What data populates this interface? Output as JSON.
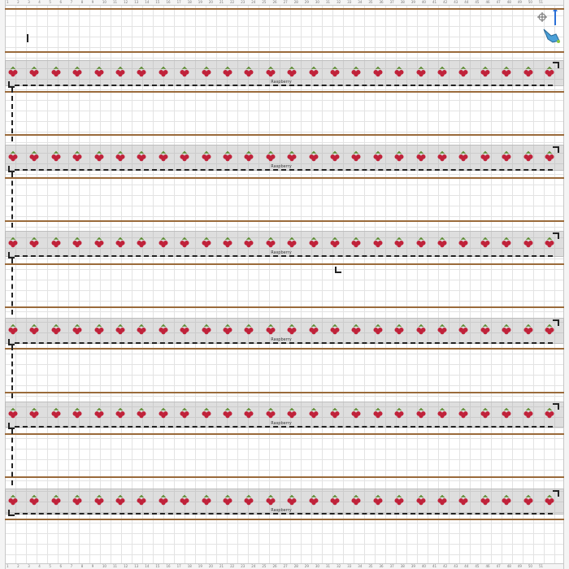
{
  "plot": {
    "crop_label": "Raspberry",
    "rows": [
      {
        "label": "Raspberry"
      },
      {
        "label": "Raspberry"
      },
      {
        "label": "Raspberry"
      },
      {
        "label": "Raspberry"
      },
      {
        "label": "Raspberry"
      },
      {
        "label": "Raspberry"
      }
    ],
    "plants_per_row": 26
  },
  "ruler": {
    "top_ticks": [
      "1",
      "2",
      "3",
      "4",
      "5",
      "6",
      "7",
      "8",
      "9",
      "10",
      "11",
      "12",
      "13",
      "14",
      "15",
      "16",
      "17",
      "18",
      "19",
      "20",
      "21",
      "22",
      "23",
      "24",
      "25",
      "26",
      "27",
      "28",
      "29",
      "30",
      "31",
      "32",
      "33",
      "34",
      "35",
      "36",
      "37",
      "38",
      "39",
      "40",
      "41",
      "42",
      "43",
      "44",
      "45",
      "46",
      "47",
      "48",
      "49",
      "50",
      "51"
    ]
  },
  "colors": {
    "berry": "#c0223a",
    "leaf": "#5a8a2e",
    "soil_line": "#9a6a3a",
    "row_bg": "#a0a0a0"
  },
  "icons": {
    "compass": "compass-icon",
    "watering_can": "watering-can-icon"
  }
}
